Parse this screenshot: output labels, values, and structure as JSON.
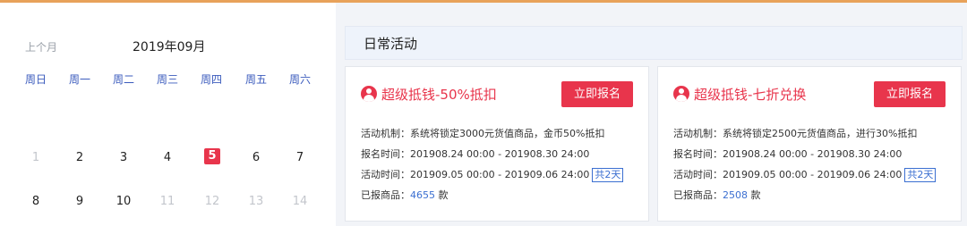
{
  "calendar": {
    "prev_month": "上个月",
    "month_title": "2019年09月",
    "weekdays": [
      "周日",
      "周一",
      "周二",
      "周三",
      "周四",
      "周五",
      "周六"
    ],
    "week1": [
      "1",
      "2",
      "3",
      "4",
      "5",
      "6",
      "7"
    ],
    "week2": [
      "8",
      "9",
      "10",
      "11",
      "12",
      "13",
      "14"
    ]
  },
  "section": {
    "title": "日常活动"
  },
  "cards": [
    {
      "title": "超级抵钱-50%抵扣",
      "button": "立即报名",
      "mechanism": "活动机制：系统将锁定3000元货值商品，金币50%抵扣",
      "signup_time": "报名时间：201908.24 00:00 - 201908.30 24:00",
      "activity_time": "活动时间：201909.05 00:00 - 201909.06 24:00",
      "duration": "共2天",
      "items_label": "已报商品：",
      "items_count": "4655",
      "items_unit": "款"
    },
    {
      "title": "超级抵钱-七折兑换",
      "button": "立即报名",
      "mechanism": "活动机制：系统将锁定2500元货值商品，进行30%抵扣",
      "signup_time": "报名时间：201908.24 00:00 - 201908.30 24:00",
      "activity_time": "活动时间：201909.05 00:00 - 201909.06 24:00",
      "duration": "共2天",
      "items_label": "已报商品：",
      "items_count": "2508",
      "items_unit": "款"
    }
  ],
  "colors": {
    "accent": "#e8354c",
    "link": "#3b6fd1",
    "topline": "#e8a25a"
  }
}
